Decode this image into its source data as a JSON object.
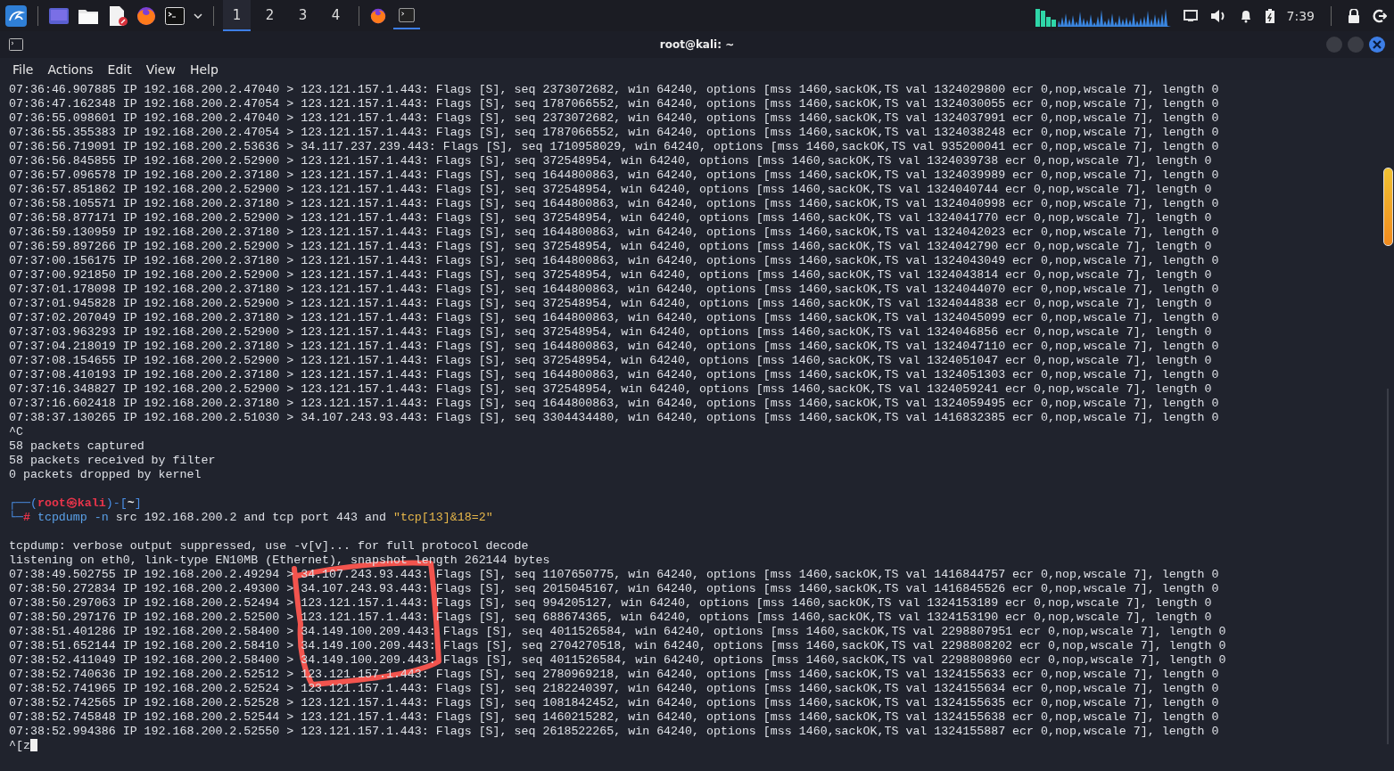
{
  "taskbar": {
    "workspaces": [
      {
        "label": "1",
        "selected": true
      },
      {
        "label": "2",
        "selected": false
      },
      {
        "label": "3",
        "selected": false
      },
      {
        "label": "4",
        "selected": false
      }
    ],
    "clock": "7:39"
  },
  "window": {
    "title": "root@kali: ~"
  },
  "menu": [
    "File",
    "Actions",
    "Edit",
    "View",
    "Help"
  ],
  "terminal": {
    "lines": [
      {
        "kind": "output",
        "text": "07:36:46.907885 IP 192.168.200.2.47040 > 123.121.157.1.443: Flags [S], seq 2373072682, win 64240, options [mss 1460,sackOK,TS val 1324029800 ecr 0,nop,wscale 7], length 0"
      },
      {
        "kind": "output",
        "text": "07:36:47.162348 IP 192.168.200.2.47054 > 123.121.157.1.443: Flags [S], seq 1787066552, win 64240, options [mss 1460,sackOK,TS val 1324030055 ecr 0,nop,wscale 7], length 0"
      },
      {
        "kind": "output",
        "text": "07:36:55.098601 IP 192.168.200.2.47040 > 123.121.157.1.443: Flags [S], seq 2373072682, win 64240, options [mss 1460,sackOK,TS val 1324037991 ecr 0,nop,wscale 7], length 0"
      },
      {
        "kind": "output",
        "text": "07:36:55.355383 IP 192.168.200.2.47054 > 123.121.157.1.443: Flags [S], seq 1787066552, win 64240, options [mss 1460,sackOK,TS val 1324038248 ecr 0,nop,wscale 7], length 0"
      },
      {
        "kind": "output",
        "text": "07:36:56.719091 IP 192.168.200.2.53636 > 34.117.237.239.443: Flags [S], seq 1710958029, win 64240, options [mss 1460,sackOK,TS val 935200041 ecr 0,nop,wscale 7], length 0"
      },
      {
        "kind": "output",
        "text": "07:36:56.845855 IP 192.168.200.2.52900 > 123.121.157.1.443: Flags [S], seq 372548954, win 64240, options [mss 1460,sackOK,TS val 1324039738 ecr 0,nop,wscale 7], length 0"
      },
      {
        "kind": "output",
        "text": "07:36:57.096578 IP 192.168.200.2.37180 > 123.121.157.1.443: Flags [S], seq 1644800863, win 64240, options [mss 1460,sackOK,TS val 1324039989 ecr 0,nop,wscale 7], length 0"
      },
      {
        "kind": "output",
        "text": "07:36:57.851862 IP 192.168.200.2.52900 > 123.121.157.1.443: Flags [S], seq 372548954, win 64240, options [mss 1460,sackOK,TS val 1324040744 ecr 0,nop,wscale 7], length 0"
      },
      {
        "kind": "output",
        "text": "07:36:58.105571 IP 192.168.200.2.37180 > 123.121.157.1.443: Flags [S], seq 1644800863, win 64240, options [mss 1460,sackOK,TS val 1324040998 ecr 0,nop,wscale 7], length 0"
      },
      {
        "kind": "output",
        "text": "07:36:58.877171 IP 192.168.200.2.52900 > 123.121.157.1.443: Flags [S], seq 372548954, win 64240, options [mss 1460,sackOK,TS val 1324041770 ecr 0,nop,wscale 7], length 0"
      },
      {
        "kind": "output",
        "text": "07:36:59.130959 IP 192.168.200.2.37180 > 123.121.157.1.443: Flags [S], seq 1644800863, win 64240, options [mss 1460,sackOK,TS val 1324042023 ecr 0,nop,wscale 7], length 0"
      },
      {
        "kind": "output",
        "text": "07:36:59.897266 IP 192.168.200.2.52900 > 123.121.157.1.443: Flags [S], seq 372548954, win 64240, options [mss 1460,sackOK,TS val 1324042790 ecr 0,nop,wscale 7], length 0"
      },
      {
        "kind": "output",
        "text": "07:37:00.156175 IP 192.168.200.2.37180 > 123.121.157.1.443: Flags [S], seq 1644800863, win 64240, options [mss 1460,sackOK,TS val 1324043049 ecr 0,nop,wscale 7], length 0"
      },
      {
        "kind": "output",
        "text": "07:37:00.921850 IP 192.168.200.2.52900 > 123.121.157.1.443: Flags [S], seq 372548954, win 64240, options [mss 1460,sackOK,TS val 1324043814 ecr 0,nop,wscale 7], length 0"
      },
      {
        "kind": "output",
        "text": "07:37:01.178098 IP 192.168.200.2.37180 > 123.121.157.1.443: Flags [S], seq 1644800863, win 64240, options [mss 1460,sackOK,TS val 1324044070 ecr 0,nop,wscale 7], length 0"
      },
      {
        "kind": "output",
        "text": "07:37:01.945828 IP 192.168.200.2.52900 > 123.121.157.1.443: Flags [S], seq 372548954, win 64240, options [mss 1460,sackOK,TS val 1324044838 ecr 0,nop,wscale 7], length 0"
      },
      {
        "kind": "output",
        "text": "07:37:02.207049 IP 192.168.200.2.37180 > 123.121.157.1.443: Flags [S], seq 1644800863, win 64240, options [mss 1460,sackOK,TS val 1324045099 ecr 0,nop,wscale 7], length 0"
      },
      {
        "kind": "output",
        "text": "07:37:03.963293 IP 192.168.200.2.52900 > 123.121.157.1.443: Flags [S], seq 372548954, win 64240, options [mss 1460,sackOK,TS val 1324046856 ecr 0,nop,wscale 7], length 0"
      },
      {
        "kind": "output",
        "text": "07:37:04.218019 IP 192.168.200.2.37180 > 123.121.157.1.443: Flags [S], seq 1644800863, win 64240, options [mss 1460,sackOK,TS val 1324047110 ecr 0,nop,wscale 7], length 0"
      },
      {
        "kind": "output",
        "text": "07:37:08.154655 IP 192.168.200.2.52900 > 123.121.157.1.443: Flags [S], seq 372548954, win 64240, options [mss 1460,sackOK,TS val 1324051047 ecr 0,nop,wscale 7], length 0"
      },
      {
        "kind": "output",
        "text": "07:37:08.410193 IP 192.168.200.2.37180 > 123.121.157.1.443: Flags [S], seq 1644800863, win 64240, options [mss 1460,sackOK,TS val 1324051303 ecr 0,nop,wscale 7], length 0"
      },
      {
        "kind": "output",
        "text": "07:37:16.348827 IP 192.168.200.2.52900 > 123.121.157.1.443: Flags [S], seq 372548954, win 64240, options [mss 1460,sackOK,TS val 1324059241 ecr 0,nop,wscale 7], length 0"
      },
      {
        "kind": "output",
        "text": "07:37:16.602418 IP 192.168.200.2.37180 > 123.121.157.1.443: Flags [S], seq 1644800863, win 64240, options [mss 1460,sackOK,TS val 1324059495 ecr 0,nop,wscale 7], length 0"
      },
      {
        "kind": "output",
        "text": "07:38:37.130265 IP 192.168.200.2.51030 > 34.107.243.93.443: Flags [S], seq 3304434480, win 64240, options [mss 1460,sackOK,TS val 1416832385 ecr 0,nop,wscale 7], length 0"
      },
      {
        "kind": "output",
        "text": "^C"
      },
      {
        "kind": "output",
        "text": "58 packets captured"
      },
      {
        "kind": "output",
        "text": "58 packets received by filter"
      },
      {
        "kind": "output",
        "text": "0 packets dropped by kernel"
      },
      {
        "kind": "blank"
      },
      {
        "kind": "prompt",
        "segments": [
          {
            "kind": "frame",
            "text": "┌──("
          },
          {
            "kind": "user",
            "text": "root㉿kali"
          },
          {
            "kind": "frame",
            "text": ")-["
          },
          {
            "kind": "path",
            "text": "~"
          },
          {
            "kind": "frame",
            "text": "]"
          }
        ]
      },
      {
        "kind": "prompt",
        "segments": [
          {
            "kind": "frame",
            "text": "└─"
          },
          {
            "kind": "user",
            "text": "#"
          },
          {
            "kind": "command",
            "text": " tcpdump -n"
          },
          {
            "kind": "arg",
            "text": " src 192.168.200.2 and tcp port 443 and "
          },
          {
            "kind": "string",
            "text": "\"tcp[13]&18=2\""
          }
        ]
      },
      {
        "kind": "blank"
      },
      {
        "kind": "output",
        "text": "tcpdump: verbose output suppressed, use -v[v]... for full protocol decode"
      },
      {
        "kind": "output",
        "text": "listening on eth0, link-type EN10MB (Ethernet), snapshot length 262144 bytes"
      },
      {
        "kind": "output",
        "text": "07:38:49.502755 IP 192.168.200.2.49294 > 34.107.243.93.443: Flags [S], seq 1107650775, win 64240, options [mss 1460,sackOK,TS val 1416844757 ecr 0,nop,wscale 7], length 0"
      },
      {
        "kind": "output",
        "text": "07:38:50.272834 IP 192.168.200.2.49300 > 34.107.243.93.443: Flags [S], seq 2015045167, win 64240, options [mss 1460,sackOK,TS val 1416845526 ecr 0,nop,wscale 7], length 0"
      },
      {
        "kind": "output",
        "text": "07:38:50.297063 IP 192.168.200.2.52494 > 123.121.157.1.443: Flags [S], seq 994205127, win 64240, options [mss 1460,sackOK,TS val 1324153189 ecr 0,nop,wscale 7], length 0"
      },
      {
        "kind": "output",
        "text": "07:38:50.297176 IP 192.168.200.2.52500 > 123.121.157.1.443: Flags [S], seq 688674365, win 64240, options [mss 1460,sackOK,TS val 1324153190 ecr 0,nop,wscale 7], length 0"
      },
      {
        "kind": "output",
        "text": "07:38:51.401286 IP 192.168.200.2.58400 > 34.149.100.209.443: Flags [S], seq 4011526584, win 64240, options [mss 1460,sackOK,TS val 2298807951 ecr 0,nop,wscale 7], length 0"
      },
      {
        "kind": "output",
        "text": "07:38:51.652144 IP 192.168.200.2.58410 > 34.149.100.209.443: Flags [S], seq 2704270518, win 64240, options [mss 1460,sackOK,TS val 2298808202 ecr 0,nop,wscale 7], length 0"
      },
      {
        "kind": "output",
        "text": "07:38:52.411049 IP 192.168.200.2.58400 > 34.149.100.209.443: Flags [S], seq 4011526584, win 64240, options [mss 1460,sackOK,TS val 2298808960 ecr 0,nop,wscale 7], length 0"
      },
      {
        "kind": "output",
        "text": "07:38:52.740636 IP 192.168.200.2.52512 > 123.121.157.1.443: Flags [S], seq 2780969218, win 64240, options [mss 1460,sackOK,TS val 1324155633 ecr 0,nop,wscale 7], length 0"
      },
      {
        "kind": "output",
        "text": "07:38:52.741965 IP 192.168.200.2.52524 > 123.121.157.1.443: Flags [S], seq 2182240397, win 64240, options [mss 1460,sackOK,TS val 1324155634 ecr 0,nop,wscale 7], length 0"
      },
      {
        "kind": "output",
        "text": "07:38:52.742565 IP 192.168.200.2.52528 > 123.121.157.1.443: Flags [S], seq 1081842452, win 64240, options [mss 1460,sackOK,TS val 1324155635 ecr 0,nop,wscale 7], length 0"
      },
      {
        "kind": "output",
        "text": "07:38:52.745848 IP 192.168.200.2.52544 > 123.121.157.1.443: Flags [S], seq 1460215282, win 64240, options [mss 1460,sackOK,TS val 1324155638 ecr 0,nop,wscale 7], length 0"
      },
      {
        "kind": "output",
        "text": "07:38:52.994386 IP 192.168.200.2.52550 > 123.121.157.1.443: Flags [S], seq 2618522265, win 64240, options [mss 1460,sackOK,TS val 1324155887 ecr 0,nop,wscale 7], length 0"
      },
      {
        "kind": "input",
        "text": "^[z",
        "cursor": true
      }
    ]
  }
}
